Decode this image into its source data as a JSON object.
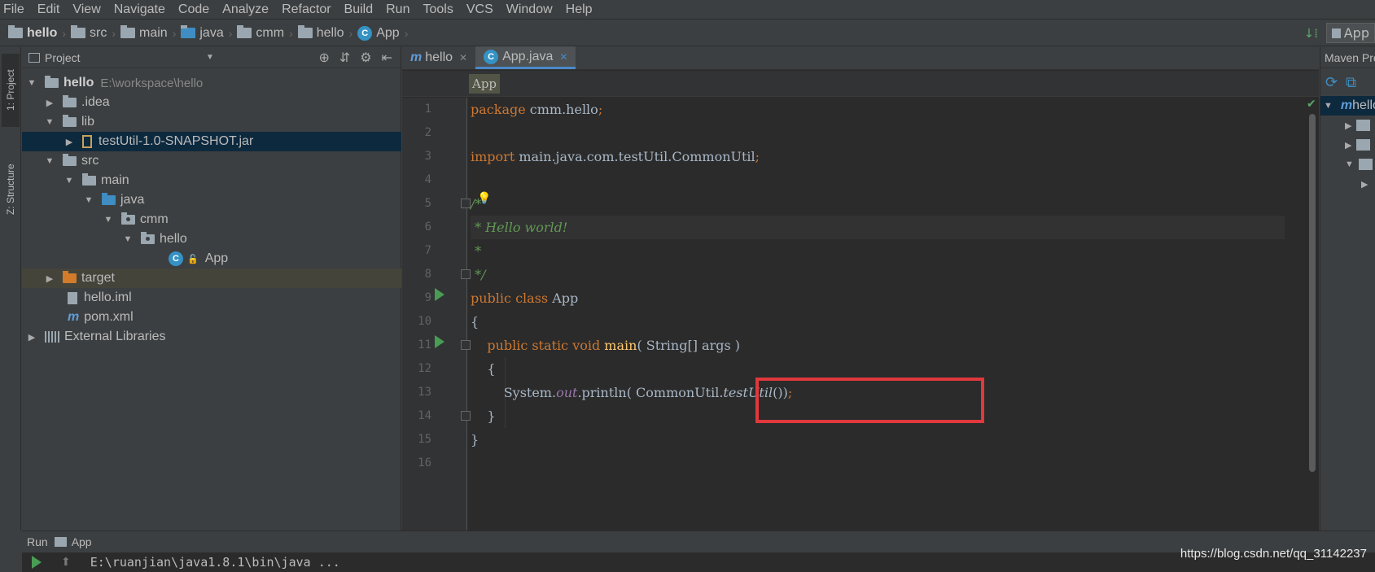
{
  "menu": [
    "File",
    "Edit",
    "View",
    "Navigate",
    "Code",
    "Analyze",
    "Refactor",
    "Build",
    "Run",
    "Tools",
    "VCS",
    "Window",
    "Help"
  ],
  "breadcrumbs": [
    "hello",
    "src",
    "main",
    "java",
    "cmm",
    "hello",
    "App"
  ],
  "run_config": "App",
  "left_tabs": {
    "project": "1: Project",
    "structure": "Z: Structure"
  },
  "project_panel": {
    "title": "Project",
    "tree": [
      {
        "label": "hello",
        "path": "E:\\workspace\\hello",
        "icon": "module-folder-icon"
      },
      {
        "label": ".idea",
        "icon": "folder-icon"
      },
      {
        "label": "lib",
        "icon": "folder-icon"
      },
      {
        "label": "testUtil-1.0-SNAPSHOT.jar",
        "icon": "jar-icon"
      },
      {
        "label": "src",
        "icon": "folder-icon"
      },
      {
        "label": "main",
        "icon": "folder-icon"
      },
      {
        "label": "java",
        "icon": "source-folder-icon"
      },
      {
        "label": "cmm",
        "icon": "package-icon"
      },
      {
        "label": "hello",
        "icon": "package-icon"
      },
      {
        "label": "App",
        "icon": "class-icon"
      },
      {
        "label": "target",
        "icon": "excluded-folder-icon"
      },
      {
        "label": "hello.iml",
        "icon": "iml-file-icon"
      },
      {
        "label": "pom.xml",
        "icon": "maven-icon"
      },
      {
        "label": "External Libraries",
        "icon": "libraries-icon"
      }
    ]
  },
  "editor": {
    "tabs": [
      {
        "label": "hello",
        "icon": "maven-icon",
        "active": false
      },
      {
        "label": "App.java",
        "icon": "class-icon",
        "active": true
      }
    ],
    "breadcrumb_chip": "App",
    "line_numbers": [
      "1",
      "2",
      "3",
      "4",
      "5",
      "6",
      "7",
      "8",
      "9",
      "10",
      "11",
      "12",
      "13",
      "14",
      "15",
      "16"
    ],
    "code": {
      "l1_kw": "package",
      "l1_rest": " cmm.hello",
      "l1_semi": ";",
      "l3_kw": "import",
      "l3_rest": " main.java.com.testUtil.CommonUtil",
      "l3_semi": ";",
      "l5": "/*",
      "l6": " * Hello world!",
      "l7": " *",
      "l8": " */",
      "l9_kw": "public class",
      "l9_rest": " App",
      "l10": "{",
      "l11_kw": "    public static void",
      "l11_fn": " main",
      "l11_rest": "( String[] args )",
      "l12": "    {",
      "l13_a": "        System.",
      "l13_out": "out",
      "l13_b": ".println( CommonUtil.",
      "l13_call": "testUtil",
      "l13_c": "())",
      "l13_semi": ";",
      "l14": "    }",
      "l15": "}"
    }
  },
  "maven_panel": {
    "title": "Maven Projects",
    "root": "hello"
  },
  "run_panel": {
    "label": "Run",
    "config": "App",
    "command": "E:\\ruanjian\\java1.8.1\\bin\\java ..."
  },
  "watermark": "https://blog.csdn.net/qq_31142237",
  "colors": {
    "highlight_box": "#e0383c",
    "keyword": "#cc7832",
    "comment": "#629755"
  }
}
